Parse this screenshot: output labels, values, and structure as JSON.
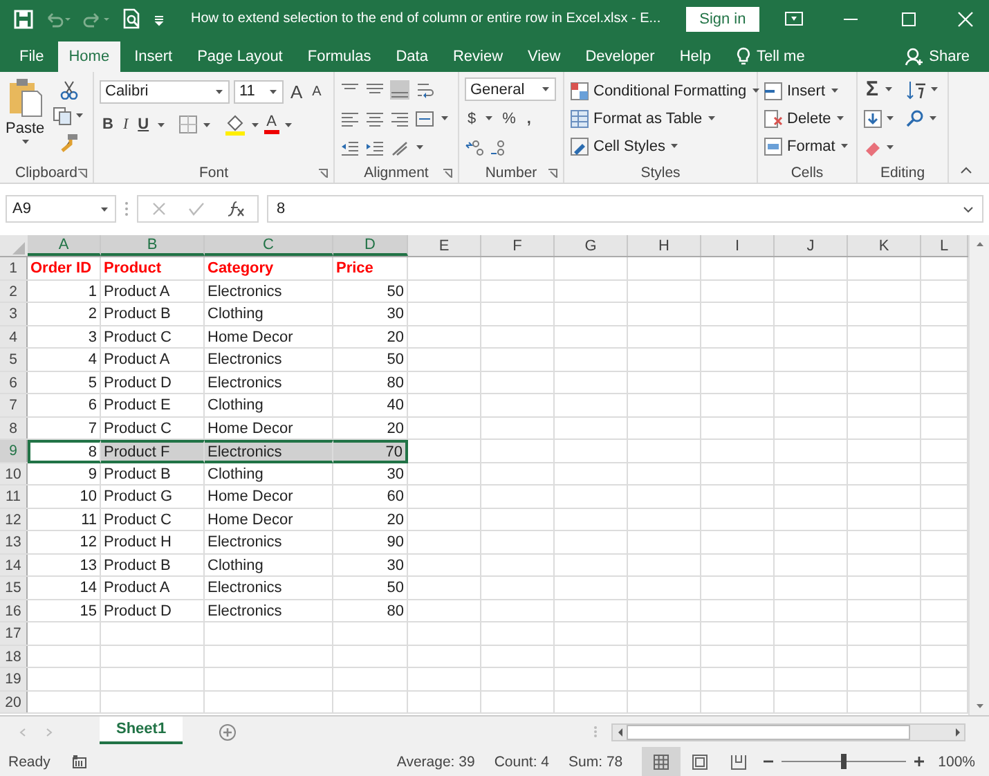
{
  "title_bar": {
    "title": "How to extend selection to the end of column or entire row in Excel.xlsx  -  E...",
    "sign_in": "Sign in"
  },
  "ribbon_tabs": [
    {
      "label": "File",
      "selected": false
    },
    {
      "label": "Home",
      "selected": true
    },
    {
      "label": "Insert",
      "selected": false
    },
    {
      "label": "Page Layout",
      "selected": false
    },
    {
      "label": "Formulas",
      "selected": false
    },
    {
      "label": "Data",
      "selected": false
    },
    {
      "label": "Review",
      "selected": false
    },
    {
      "label": "View",
      "selected": false
    },
    {
      "label": "Developer",
      "selected": false
    },
    {
      "label": "Help",
      "selected": false
    }
  ],
  "tell_me": "Tell me",
  "share": "Share",
  "ribbon": {
    "clipboard": {
      "paste": "Paste",
      "label": "Clipboard"
    },
    "font": {
      "name": "Calibri",
      "size": "11",
      "grow": "A",
      "shrink": "A",
      "bold": "B",
      "italic": "I",
      "underline": "U",
      "font_color": "A",
      "label": "Font"
    },
    "alignment": {
      "label": "Alignment"
    },
    "number": {
      "format": "General",
      "currency": "$",
      "percent": "%",
      "comma": ",",
      "label": "Number"
    },
    "styles": {
      "items": [
        "Conditional Formatting",
        "Format as Table",
        "Cell Styles"
      ],
      "label": "Styles"
    },
    "cells": {
      "items": [
        "Insert",
        "Delete",
        "Format"
      ],
      "label": "Cells"
    },
    "editing": {
      "sum": "Σ",
      "label": "Editing"
    }
  },
  "formula_bar": {
    "name_box": "A9",
    "value": "8"
  },
  "sheet": {
    "columns": [
      {
        "label": "A",
        "selected": true,
        "kind": "number"
      },
      {
        "label": "B",
        "selected": true,
        "kind": "text"
      },
      {
        "label": "C",
        "selected": true,
        "kind": "text"
      },
      {
        "label": "D",
        "selected": true,
        "kind": "number"
      },
      {
        "label": "E",
        "selected": false
      },
      {
        "label": "F",
        "selected": false
      },
      {
        "label": "G",
        "selected": false
      },
      {
        "label": "H",
        "selected": false
      },
      {
        "label": "I",
        "selected": false
      },
      {
        "label": "J",
        "selected": false
      },
      {
        "label": "K",
        "selected": false
      },
      {
        "label": "L",
        "selected": false
      }
    ],
    "rows": [
      {
        "number": "1",
        "kind": "header",
        "selected": false,
        "cells": [
          "Order ID",
          "Product",
          "Category",
          "Price"
        ]
      },
      {
        "number": "2",
        "kind": "data",
        "selected": false,
        "cells": [
          "1",
          "Product A",
          "Electronics",
          "50"
        ]
      },
      {
        "number": "3",
        "kind": "data",
        "selected": false,
        "cells": [
          "2",
          "Product B",
          "Clothing",
          "30"
        ]
      },
      {
        "number": "4",
        "kind": "data",
        "selected": false,
        "cells": [
          "3",
          "Product C",
          "Home Decor",
          "20"
        ]
      },
      {
        "number": "5",
        "kind": "data",
        "selected": false,
        "cells": [
          "4",
          "Product A",
          "Electronics",
          "50"
        ]
      },
      {
        "number": "6",
        "kind": "data",
        "selected": false,
        "cells": [
          "5",
          "Product D",
          "Electronics",
          "80"
        ]
      },
      {
        "number": "7",
        "kind": "data",
        "selected": false,
        "cells": [
          "6",
          "Product E",
          "Clothing",
          "40"
        ]
      },
      {
        "number": "8",
        "kind": "data",
        "selected": false,
        "cells": [
          "7",
          "Product C",
          "Home Decor",
          "20"
        ]
      },
      {
        "number": "9",
        "kind": "data",
        "selected": true,
        "cells": [
          "8",
          "Product F",
          "Electronics",
          "70"
        ]
      },
      {
        "number": "10",
        "kind": "data",
        "selected": false,
        "cells": [
          "9",
          "Product B",
          "Clothing",
          "30"
        ]
      },
      {
        "number": "11",
        "kind": "data",
        "selected": false,
        "cells": [
          "10",
          "Product G",
          "Home Decor",
          "60"
        ]
      },
      {
        "number": "12",
        "kind": "data",
        "selected": false,
        "cells": [
          "11",
          "Product C",
          "Home Decor",
          "20"
        ]
      },
      {
        "number": "13",
        "kind": "data",
        "selected": false,
        "cells": [
          "12",
          "Product H",
          "Electronics",
          "90"
        ]
      },
      {
        "number": "14",
        "kind": "data",
        "selected": false,
        "cells": [
          "13",
          "Product B",
          "Clothing",
          "30"
        ]
      },
      {
        "number": "15",
        "kind": "data",
        "selected": false,
        "cells": [
          "14",
          "Product A",
          "Electronics",
          "50"
        ]
      },
      {
        "number": "16",
        "kind": "data",
        "selected": false,
        "cells": [
          "15",
          "Product D",
          "Electronics",
          "80"
        ]
      },
      {
        "number": "17",
        "kind": "data",
        "selected": false,
        "cells": []
      },
      {
        "number": "18",
        "kind": "data",
        "selected": false,
        "cells": []
      },
      {
        "number": "19",
        "kind": "data",
        "selected": false,
        "cells": []
      },
      {
        "number": "20",
        "kind": "data",
        "selected": false,
        "cells": []
      }
    ]
  },
  "sheet_tabs": [
    {
      "label": "Sheet1",
      "selected": true
    }
  ],
  "status_bar": {
    "status": "Ready",
    "average": "Average: 39",
    "count": "Count: 4",
    "sum": "Sum: 78",
    "views": [
      {
        "kind": "normal",
        "selected": true
      },
      {
        "kind": "page-layout",
        "selected": false
      },
      {
        "kind": "page-break",
        "selected": false
      }
    ],
    "zoom": {
      "level": 0.5,
      "reading": "100%"
    }
  }
}
